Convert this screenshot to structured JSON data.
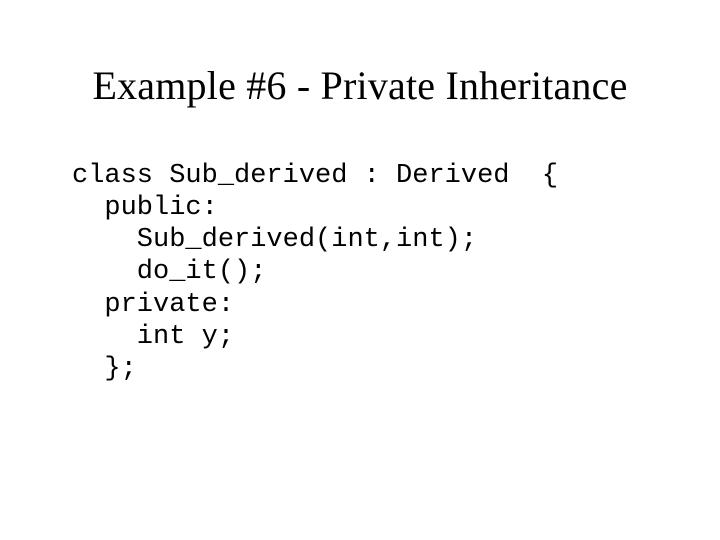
{
  "slide": {
    "title": "Example #6 - Private Inheritance",
    "code": {
      "l1": "class Sub_derived : Derived  {",
      "l2": "  public:",
      "l3": "    Sub_derived(int,int);",
      "l4": "    do_it();",
      "l5": "  private:",
      "l6": "    int y;",
      "l7": "  };"
    }
  }
}
